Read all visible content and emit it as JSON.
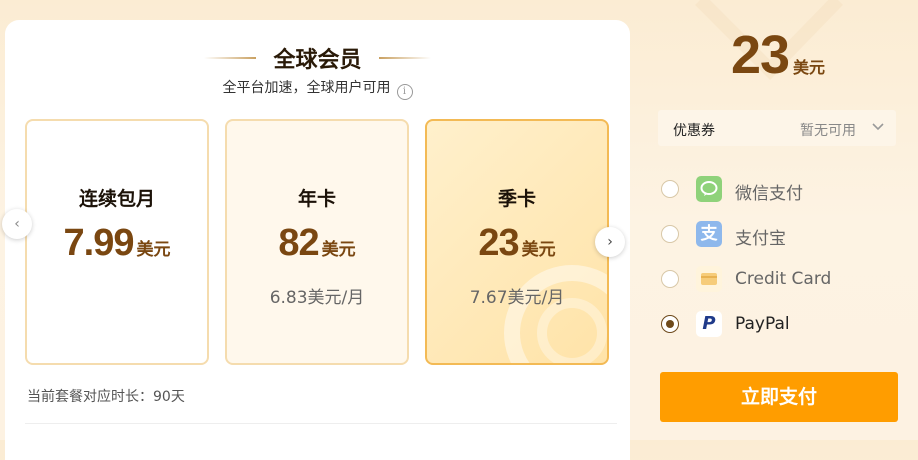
{
  "membership": {
    "title": "全球会员",
    "subtitle": "全平台加速，全球用户可用",
    "info_glyph": "i"
  },
  "plans": [
    {
      "name": "连续包月",
      "price": "7.99",
      "unit": "美元",
      "per_month": ""
    },
    {
      "name": "年卡",
      "price": "82",
      "unit": "美元",
      "per_month": "6.83美元/月"
    },
    {
      "name": "季卡",
      "price": "23",
      "unit": "美元",
      "per_month": "7.67美元/月",
      "selected": true
    }
  ],
  "nav": {
    "prev_glyph": "‹",
    "next_glyph": "›"
  },
  "duration": "当前套餐对应时长：90天",
  "checkout": {
    "total_amount": "23",
    "total_unit": "美元",
    "coupon_label": "优惠券",
    "coupon_value": "暂无可用",
    "pay_button": "立即支付"
  },
  "payment_methods": [
    {
      "name": "微信支付",
      "icon": "wechat-pay-icon",
      "selected": false
    },
    {
      "name": "支付宝",
      "icon": "alipay-icon",
      "glyph": "支",
      "selected": false
    },
    {
      "name": "Credit Card",
      "icon": "credit-card-icon",
      "selected": false
    },
    {
      "name": "PayPal",
      "icon": "paypal-icon",
      "glyph": "P",
      "selected": true
    }
  ],
  "colors": {
    "accent_brown": "#7a4711",
    "pay_button": "#ff9d00",
    "selected_plan_border": "#f3ba55",
    "plan_border": "#f5dcae",
    "wechat": "#8fd27a",
    "alipay": "#8eb8ec",
    "paypal": "#1f3a8a"
  }
}
